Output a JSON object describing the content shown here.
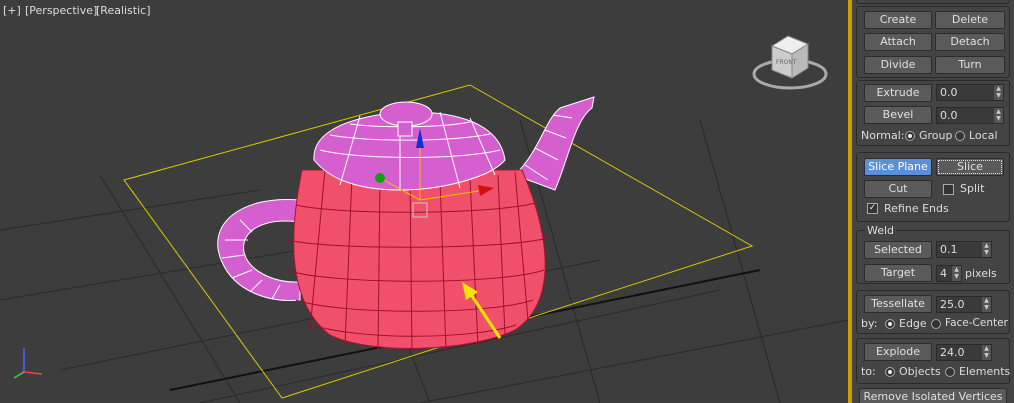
{
  "viewport": {
    "labels": {
      "plus": "[+]",
      "view": "[Perspective]",
      "shading": "[Realistic]"
    },
    "viewcube_face_text": "FRONT"
  },
  "panel": {
    "buttons": {
      "create": "Create",
      "delete": "Delete",
      "attach": "Attach",
      "detach": "Detach",
      "divide": "Divide",
      "turn": "Turn"
    },
    "extrude": {
      "label": "Extrude",
      "value": "0.0"
    },
    "bevel": {
      "label": "Bevel",
      "value": "0.0"
    },
    "normal": {
      "label": "Normal:",
      "group": "Group",
      "local": "Local",
      "selected": "Group"
    },
    "slice_plane": "Slice Plane",
    "slice": "Slice",
    "cut": "Cut",
    "split": {
      "label": "Split",
      "checked": false
    },
    "refine_ends": {
      "label": "Refine Ends",
      "checked": true
    },
    "weld": {
      "title": "Weld",
      "selected_label": "Selected",
      "selected_value": "0.1",
      "target_label": "Target",
      "target_value": "4",
      "pixels": "pixels"
    },
    "tessellate": {
      "label": "Tessellate",
      "value": "25.0",
      "by": "by:",
      "edge": "Edge",
      "face_center": "Face-Center",
      "selected": "Edge"
    },
    "explode": {
      "label": "Explode",
      "value": "24.0",
      "to": "to:",
      "objects": "Objects",
      "elements": "Elements",
      "selected": "Objects"
    },
    "remove_isolated": "Remove Isolated Vertices"
  },
  "colors": {
    "viewport_bg": "#3d3d3d",
    "active_border": "#c8a000",
    "teapot_body": "#f0506a",
    "teapot_selected": "#d65fd0",
    "slice_plane": "#e0d000",
    "arrow": "#f2e600",
    "button_active": "#5b8fd6"
  }
}
